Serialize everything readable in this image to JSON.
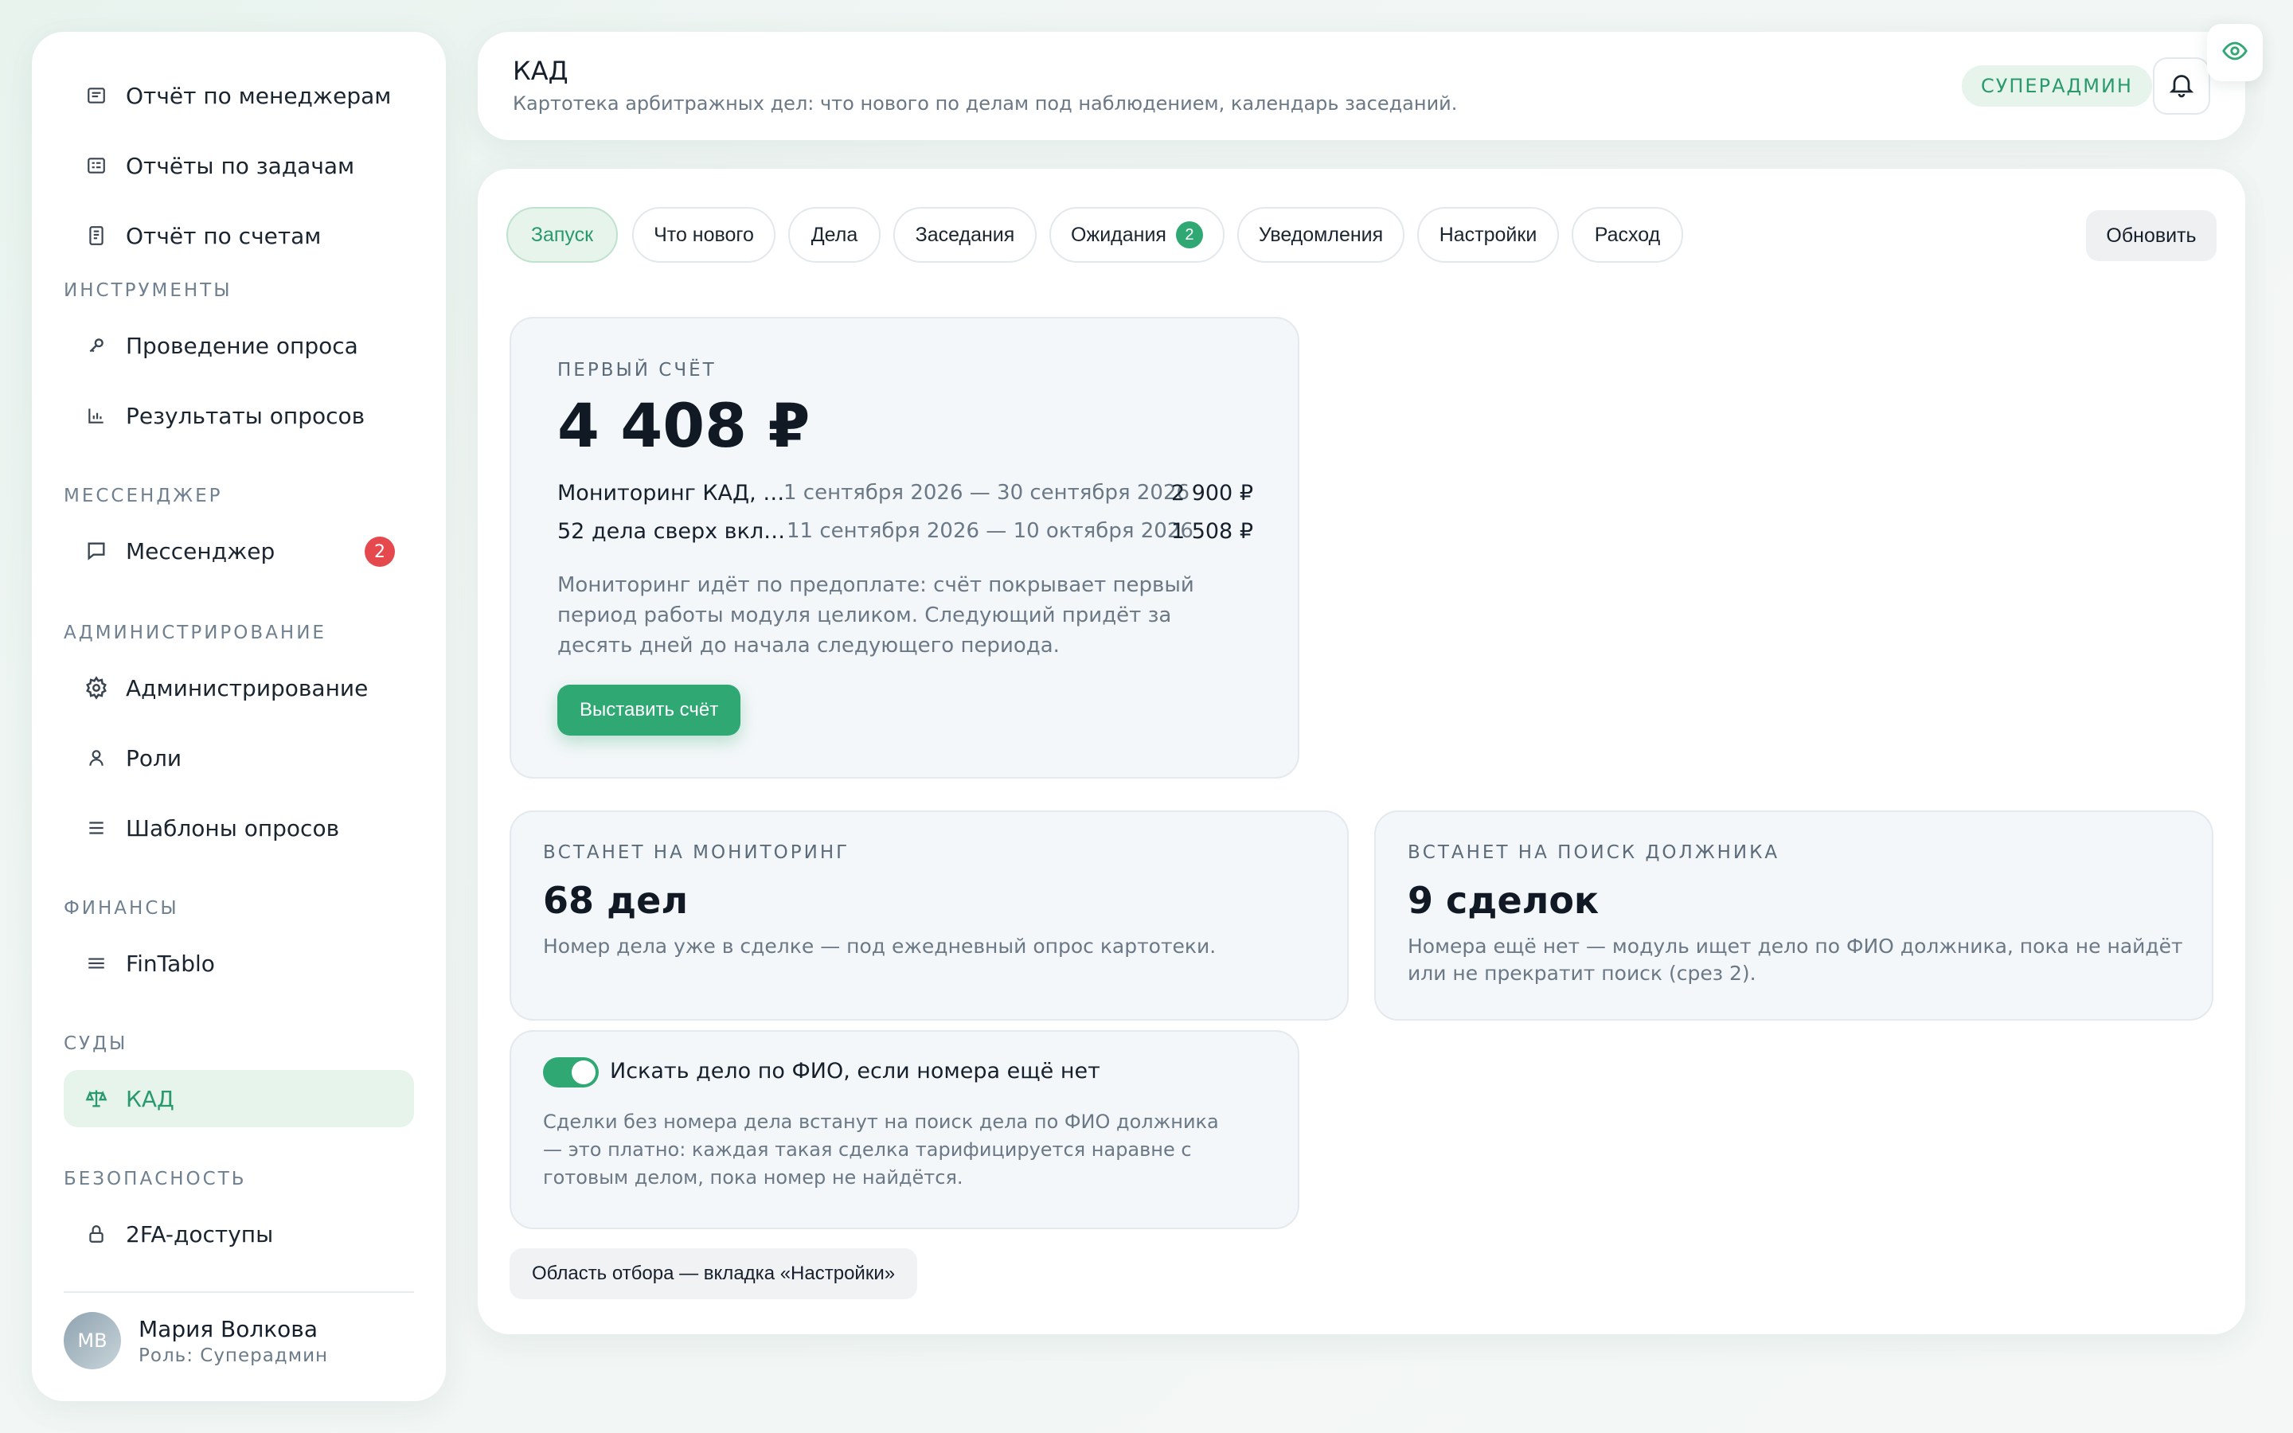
{
  "sidebar": {
    "items_top": [
      {
        "label": "Отчёт по менеджерам",
        "icon": "report-icon"
      },
      {
        "label": "Отчёты по задачам",
        "icon": "tasks-report-icon"
      },
      {
        "label": "Отчёт по счетам",
        "icon": "invoice-report-icon"
      }
    ],
    "sections": {
      "tools": {
        "title": "ИНСТРУМЕНТЫ",
        "items": [
          {
            "label": "Проведение опроса",
            "icon": "key-icon"
          },
          {
            "label": "Результаты опросов",
            "icon": "bar-chart-icon"
          }
        ]
      },
      "messenger": {
        "title": "МЕССЕНДЖЕР",
        "items": [
          {
            "label": "Мессенджер",
            "icon": "chat-icon",
            "badge": "2"
          }
        ]
      },
      "admin": {
        "title": "АДМИНИСТРИРОВАНИЕ",
        "items": [
          {
            "label": "Администрирование",
            "icon": "gear-icon"
          },
          {
            "label": "Роли",
            "icon": "person-icon"
          },
          {
            "label": "Шаблоны опросов",
            "icon": "list-icon"
          }
        ]
      },
      "finance": {
        "title": "ФИНАНСЫ",
        "items": [
          {
            "label": "FinTablo",
            "icon": "menu-icon"
          }
        ]
      },
      "courts": {
        "title": "СУДЫ",
        "items": [
          {
            "label": "КАД",
            "icon": "scales-icon",
            "active": true
          }
        ]
      },
      "security": {
        "title": "БЕЗОПАСНОСТЬ",
        "items": [
          {
            "label": "2FA-доступы",
            "icon": "lock-icon"
          }
        ]
      }
    },
    "user": {
      "initials": "МВ",
      "name": "Мария Волкова",
      "role": "Роль: Суперадмин"
    }
  },
  "header": {
    "title": "КАД",
    "subtitle": "Картотека арбитражных дел: что нового по делам под наблюдением, календарь заседаний.",
    "role_badge": "СУПЕРАДМИН"
  },
  "tabs": [
    {
      "label": "Запуск",
      "active": true
    },
    {
      "label": "Что нового"
    },
    {
      "label": "Дела"
    },
    {
      "label": "Заседания"
    },
    {
      "label": "Ожидания",
      "count": "2"
    },
    {
      "label": "Уведомления"
    },
    {
      "label": "Настройки"
    },
    {
      "label": "Расход"
    }
  ],
  "refresh_label": "Обновить",
  "first_invoice": {
    "caption": "ПЕРВЫЙ СЧЁТ",
    "amount": "4 408 ₽",
    "rows": [
      {
        "name": "Мониторинг КАД, …",
        "period": "1 сентября 2026 — 30 сентября 2026",
        "sum": "2 900 ₽"
      },
      {
        "name": "52 дела сверх вкл…",
        "period": "11 сентября 2026 — 10 октября 2026",
        "sum": "1 508 ₽"
      }
    ],
    "note": "Мониторинг идёт по предоплате: счёт покрывает первый период работы модуля целиком. Следующий придёт за десять дней до начала следующего периода.",
    "button": "Выставить счёт"
  },
  "monitoring": {
    "caption": "ВСТАНЕТ НА МОНИТОРИНГ",
    "value": "68 дел",
    "desc": "Номер дела уже в сделке — под ежедневный опрос картотеки."
  },
  "debtor_search": {
    "caption": "ВСТАНЕТ НА ПОИСК ДОЛЖНИКА",
    "value": "9 сделок",
    "desc": "Номера ещё нет — модуль ищет дело по ФИО должника, пока не найдёт или не прекратит поиск (срез 2)."
  },
  "fio_toggle": {
    "enabled": true,
    "label": "Искать дело по ФИО, если номера ещё нет",
    "note": "Сделки без номера дела встанут на поиск дела по ФИО должника — это платно: каждая такая сделка тарифицируется наравне с готовым делом, пока номер не найдётся."
  },
  "scope_chip": "Область отбора — вкладка «Настройки»",
  "colors": {
    "accent": "#2fa874",
    "accent_soft": "#e6f4ec",
    "badge_red": "#e5484d"
  }
}
